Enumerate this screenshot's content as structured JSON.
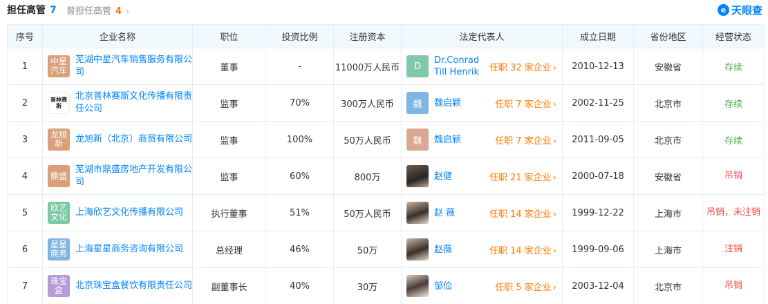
{
  "header": {
    "tab_active_label": "担任高管",
    "tab_active_count": "7",
    "tab_other_label": "曾担任高管",
    "tab_other_count": "4",
    "logo_text": "天眼查"
  },
  "columns": [
    "序号",
    "企业名称",
    "职位",
    "投资比例",
    "注册资本",
    "法定代表人",
    "成立日期",
    "省份地区",
    "经营状态"
  ],
  "rows": [
    {
      "index": "1",
      "logo_text": "中星汽车",
      "logo_color": "#d9a07a",
      "company": "芜湖中星汽车销售服务有限公司",
      "position": "董事",
      "ratio": "-",
      "capital": "11000万人民币",
      "legal_avatar": "D",
      "legal_avatar_color": "#7fc8a9",
      "legal_name": "Dr.Conrad Till Henrik",
      "legal_role": "任职 32 家企业",
      "date": "2010-12-13",
      "region": "安徽省",
      "status": "存续",
      "status_color": "green"
    },
    {
      "index": "2",
      "logo_text": "普林赛斯",
      "logo_color": "#ffffff",
      "company": "北京普林赛斯文化传播有限责任公司",
      "position": "监事",
      "ratio": "70%",
      "capital": "300万人民币",
      "legal_avatar": "魏",
      "legal_avatar_color": "#7fb5e3",
      "legal_name": "魏启颖",
      "legal_role": "任职 7 家企业",
      "date": "2002-11-25",
      "region": "北京市",
      "status": "存续",
      "status_color": "green"
    },
    {
      "index": "3",
      "logo_text": "龙旭新",
      "logo_color": "#d9a07a",
      "company": "龙旭新（北京）商贸有限公司",
      "position": "监事",
      "ratio": "100%",
      "capital": "50万人民币",
      "legal_avatar": "魏",
      "legal_avatar_color": "#d9a890",
      "legal_name": "魏启颖",
      "legal_role": "任职 7 家企业",
      "date": "2011-09-05",
      "region": "北京市",
      "status": "存续",
      "status_color": "green"
    },
    {
      "index": "4",
      "logo_text": "鼎盛",
      "logo_color": "#d9a07a",
      "company": "芜湖市鼎盛房地产开发有限公司",
      "position": "监事",
      "ratio": "60%",
      "capital": "800万",
      "legal_avatar": "",
      "legal_avatar_color": "photo",
      "legal_name": "赵健",
      "legal_role": "任职 21 家企业",
      "date": "2000-07-18",
      "region": "安徽省",
      "status": "吊销",
      "status_color": "red"
    },
    {
      "index": "5",
      "logo_text": "欣艺文化",
      "logo_color": "#7cc8a4",
      "company": "上海欣艺文化传播有限公司",
      "position": "执行董事",
      "ratio": "51%",
      "capital": "50万人民币",
      "legal_avatar": "",
      "legal_avatar_color": "photo2",
      "legal_name": "赵 薇",
      "legal_role": "任职 14 家企业",
      "date": "1999-12-22",
      "region": "上海市",
      "status": "吊销，未注销",
      "status_color": "red"
    },
    {
      "index": "6",
      "logo_text": "星星商务",
      "logo_color": "#7fb5e3",
      "company": "上海星星商务咨询有限公司",
      "position": "总经理",
      "ratio": "46%",
      "capital": "50万",
      "legal_avatar": "",
      "legal_avatar_color": "photo2",
      "legal_name": "赵薇",
      "legal_role": "任职 14 家企业",
      "date": "1999-09-06",
      "region": "上海市",
      "status": "注销",
      "status_color": "red"
    },
    {
      "index": "7",
      "logo_text": "珠宝盒",
      "logo_color": "#b79ad8",
      "company": "北京珠宝盒餐饮有限责任公司",
      "position": "副董事长",
      "ratio": "40%",
      "capital": "30万",
      "legal_avatar": "",
      "legal_avatar_color": "photo3",
      "legal_name": "邹佡",
      "legal_role": "任职 5 家企业",
      "date": "2003-12-04",
      "region": "北京市",
      "status": "吊销",
      "status_color": "red"
    }
  ]
}
